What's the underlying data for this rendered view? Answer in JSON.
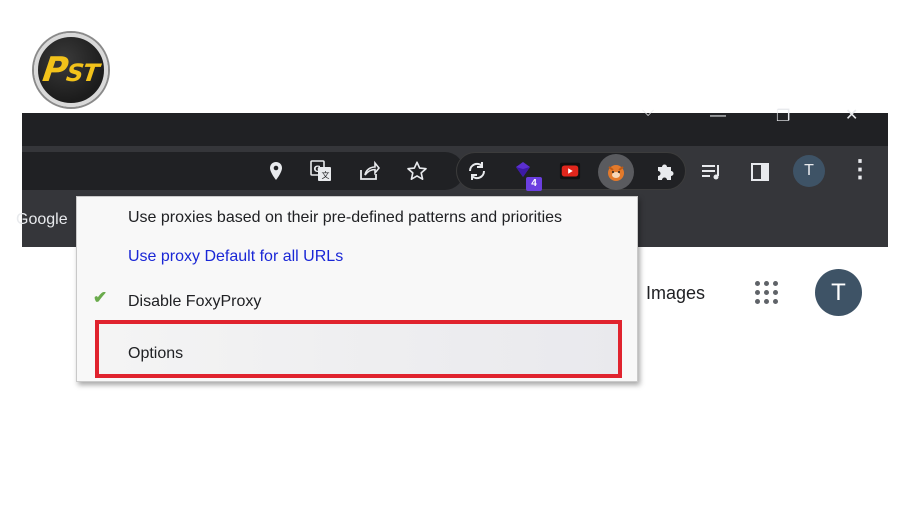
{
  "logo": {
    "text_big": "P",
    "text_small": "ST"
  },
  "window": {
    "controls": {
      "dropdown": "⌵",
      "minimize": "—",
      "restore": "❐",
      "close": "✕"
    }
  },
  "toolbar": {
    "icons": [
      "location-icon",
      "translate-icon",
      "share-icon",
      "star-icon"
    ],
    "extensions": [
      "sync-icon",
      "gem-extension-icon",
      "youtube-extension-icon",
      "foxyproxy-icon",
      "puzzle-icon"
    ],
    "extension_badge": "4",
    "right_icons": [
      "reading-list-icon",
      "side-panel-icon"
    ],
    "profile_initial": "T",
    "menu_icon": "⋮"
  },
  "bookmarks": {
    "google_label": "Google"
  },
  "page": {
    "images_link": "Images",
    "avatar_initial": "T"
  },
  "menu": {
    "items": [
      "Use proxies based on their pre-defined patterns and priorities",
      "Use proxy Default for all URLs",
      "Disable FoxyProxy",
      "Options"
    ],
    "check_mark": "✔"
  },
  "colors": {
    "titlebar": "#202124",
    "toolbar": "#35363a",
    "highlight_border": "#e0232e",
    "link_blue": "#1a27d6",
    "avatar": "#3e5366"
  }
}
